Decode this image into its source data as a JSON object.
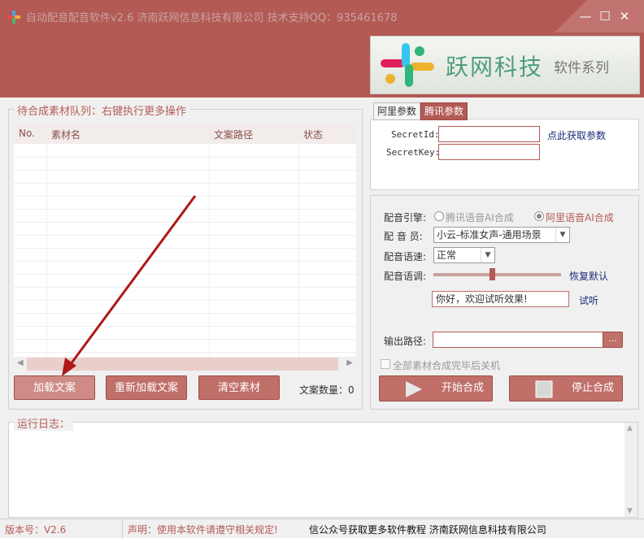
{
  "window": {
    "title": "自动配音配音软件v2.6 济南跃网信息科技有限公司 技术支持QQ：935461678",
    "minimize": "—",
    "maximize": "☐",
    "close": "✕"
  },
  "banner": {
    "brand": "跃网科技",
    "series": "软件系列"
  },
  "queue": {
    "legend": "待合成素材队列：右键执行更多操作",
    "columns": [
      "No.",
      "素材名",
      "文案路径",
      "状态"
    ],
    "rows": []
  },
  "buttons": {
    "load": "加载文案",
    "reload": "重新加载文案",
    "clear": "清空素材",
    "count_label": "文案数量：",
    "count_value": "0"
  },
  "params": {
    "tabs": [
      "阿里参数",
      "腾讯参数"
    ],
    "active_tab": "腾讯参数",
    "secret_id_label": "SecretId:",
    "secret_id_value": "",
    "secret_key_label": "SecretKey:",
    "secret_key_value": "",
    "get_params_link": "点此获取参数"
  },
  "voice": {
    "engine_label": "配音引擎:",
    "engine_options": [
      "腾讯语音AI合成",
      "阿里语音AI合成"
    ],
    "engine_selected": "阿里语音AI合成",
    "voice_label": "配 音 员:",
    "voice_value": "小云-标准女声-通用场景",
    "speed_label": "配音语速:",
    "speed_value": "正常",
    "tone_label": "配音语调:",
    "tone_level": 0.46,
    "reset_link": "恢复默认",
    "preview_text": "你好，欢迎试听效果!",
    "preview_link": "试听",
    "output_label": "输出路径:",
    "output_value": "",
    "browse_label": "...",
    "shutdown_label": "全部素材合成完毕后关机",
    "start_label": "开始合成",
    "stop_label": "停止合成"
  },
  "log": {
    "legend": "运行日志："
  },
  "statusbar": {
    "version": "版本号：V2.6",
    "notice": "声明：使用本软件请遵守相关规定!",
    "promo": "信公众号获取更多软件教程 济南跃网信息科技有限公司"
  },
  "colors": {
    "accent": "#b35a55",
    "button": "#c06f69",
    "header_text": "#8a4f4b"
  }
}
